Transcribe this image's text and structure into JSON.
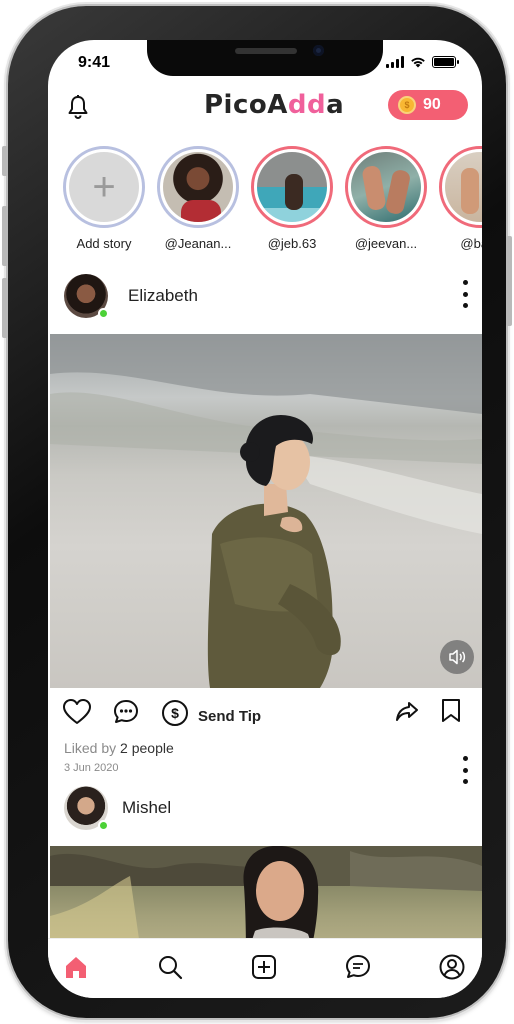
{
  "status_bar": {
    "time": "9:41"
  },
  "header": {
    "logo_part1": "Pico",
    "logo_part2": "A",
    "logo_part3": "dd",
    "logo_part4": "a",
    "coins": "90",
    "coin_symbol": "$"
  },
  "stories": [
    {
      "label": "Add story"
    },
    {
      "label": "@Jeanan..."
    },
    {
      "label": "@jeb.63"
    },
    {
      "label": "@jeevan..."
    },
    {
      "label": "@barb"
    }
  ],
  "post1": {
    "author": "Elizabeth",
    "tip_label": "Send Tip",
    "tip_symbol": "$",
    "liked_by_prefix": "Liked  by",
    "liked_by_count": "2 people",
    "date": "3 Jun 2020"
  },
  "post2": {
    "author": "Mishel"
  },
  "colors": {
    "accent": "#f35f73",
    "logo_pink": "#f0609b",
    "online": "#4cd137",
    "home_active": "#f35f73"
  },
  "icons": [
    "bell-icon",
    "coin-icon",
    "plus-icon",
    "heart-icon",
    "comment-icon",
    "dollar-icon",
    "share-icon",
    "bookmark-icon",
    "sound-icon",
    "home-icon",
    "search-icon",
    "add-post-icon",
    "chat-icon",
    "profile-icon",
    "more-icon"
  ]
}
